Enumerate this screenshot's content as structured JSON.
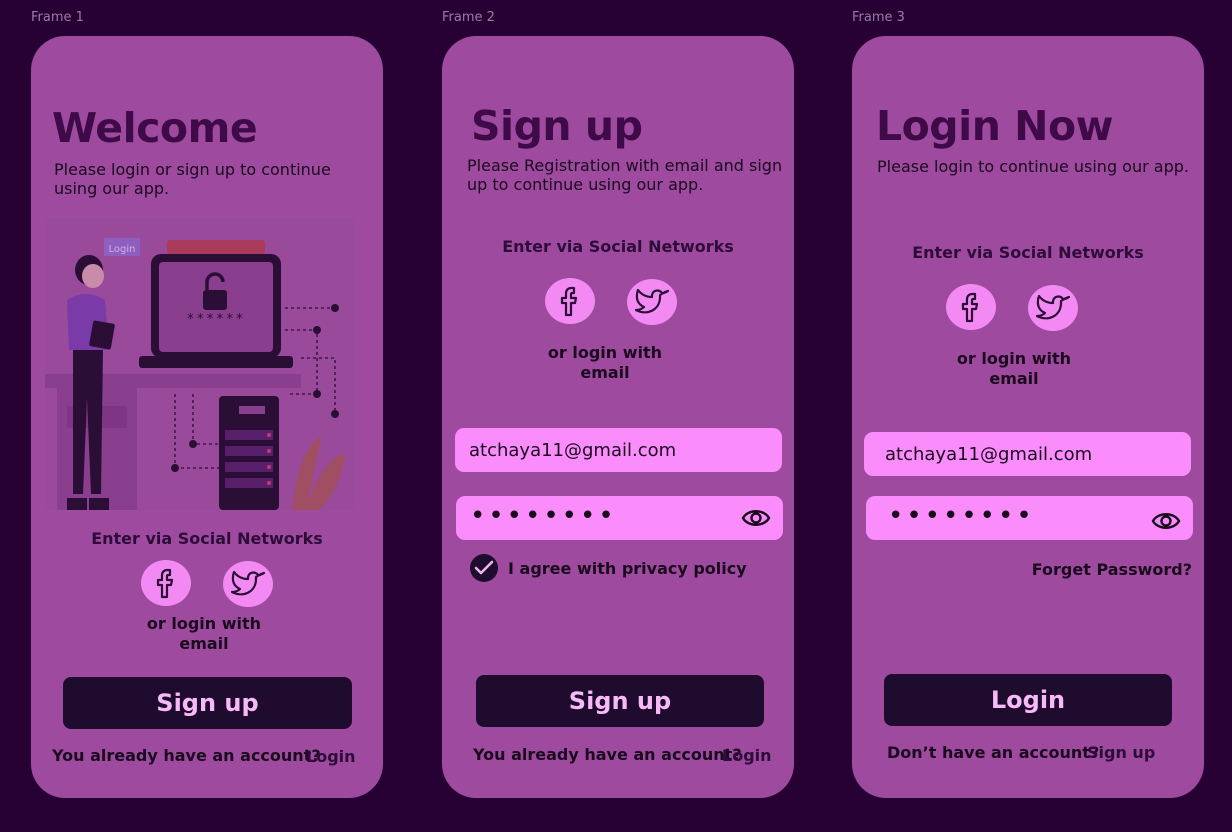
{
  "frames": [
    {
      "label": "Frame 1",
      "title": "Welcome",
      "subtitle": "Please login or sign up to continue using our app.",
      "illustration": {
        "login_tag": "Login",
        "password_mask": "******"
      },
      "social_title": "Enter via Social Networks",
      "social_icons": [
        "facebook-icon",
        "twitter-icon"
      ],
      "or_email": [
        "or login with",
        "email"
      ],
      "primary_button": "Sign up",
      "footer_text": "You already have an account?",
      "footer_link": "Login"
    },
    {
      "label": "Frame 2",
      "title": "Sign up",
      "subtitle": "Please Registration with email and  sign up to continue using our app.",
      "social_title": "Enter via Social Networks",
      "social_icons": [
        "facebook-icon",
        "twitter-icon"
      ],
      "or_email": [
        "or login with",
        "email"
      ],
      "email_value": "atchaya11@gmail.com",
      "password_value": "••••••••",
      "checkbox_label": "I agree with privacy policy",
      "primary_button": "Sign up",
      "footer_text": "You already have an account?",
      "footer_link": "Login"
    },
    {
      "label": "Frame 3",
      "title": "Login Now",
      "subtitle": "Please login  to continue using our app.",
      "social_title": "Enter via Social Networks",
      "social_icons": [
        "facebook-icon",
        "twitter-icon"
      ],
      "or_email": [
        "or login with",
        "email"
      ],
      "email_value": "atchaya11@gmail.com",
      "password_value": "••••••••",
      "forgot_link": "Forget Password?",
      "primary_button": "Login",
      "footer_text": "Don’t have an account?",
      "footer_link": "Sign up"
    }
  ],
  "colors": {
    "canvas": "#270134",
    "card": "#9e4a9e",
    "title": "#3e0a48",
    "input": "#fb8cfb",
    "button": "#1e0b2e",
    "button_text": "#f7b9f7",
    "social_bg": "#f38af3"
  }
}
